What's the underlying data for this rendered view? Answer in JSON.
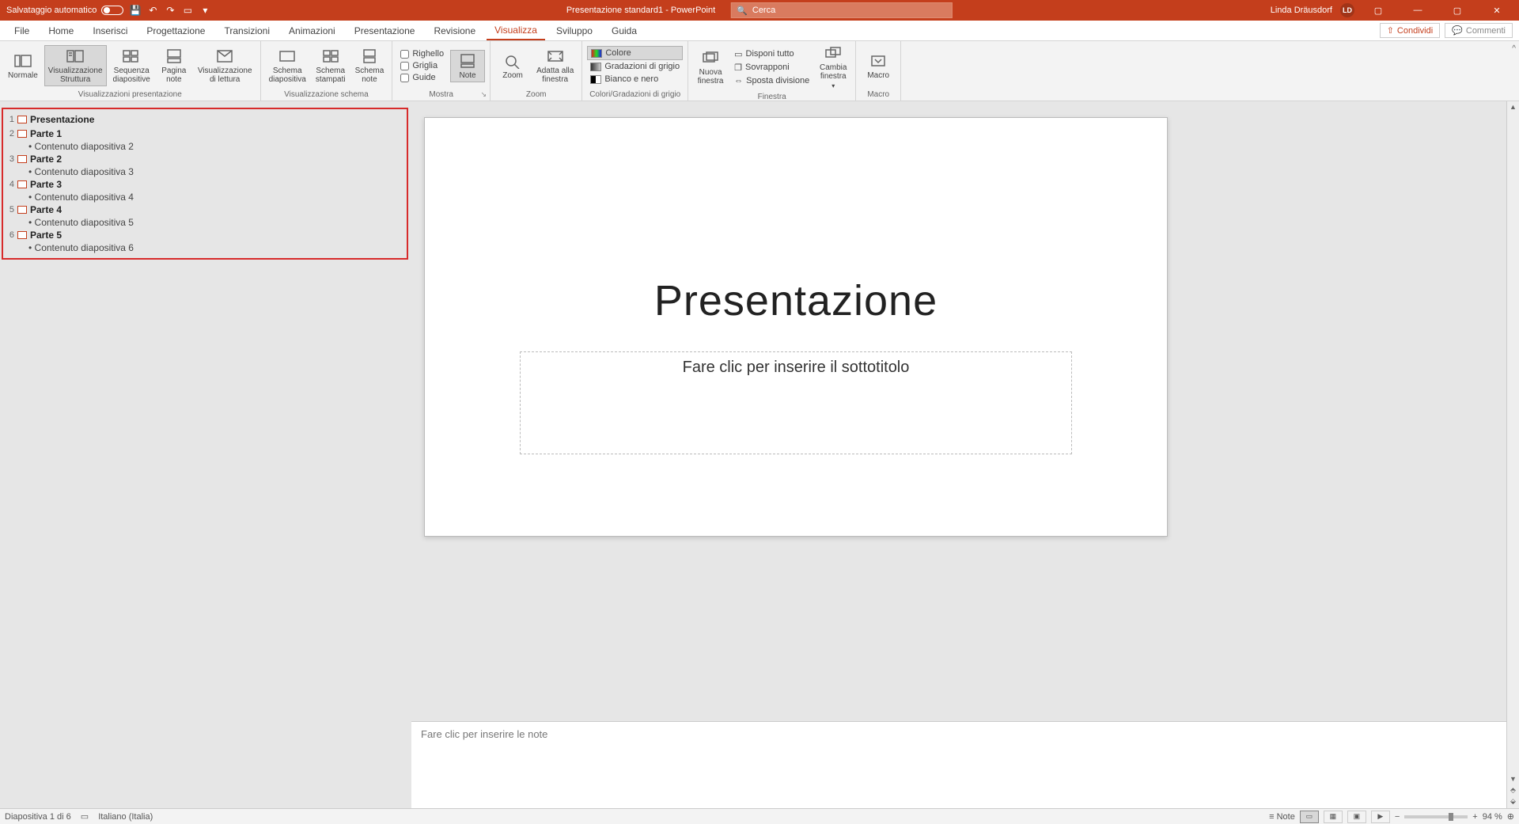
{
  "titlebar": {
    "autosave_label": "Salvataggio automatico",
    "doc_title": "Presentazione standard1 - PowerPoint",
    "search_placeholder": "Cerca",
    "user_name": "Linda Dräusdorf",
    "user_initials": "LD"
  },
  "tabs": {
    "items": [
      "File",
      "Home",
      "Inserisci",
      "Progettazione",
      "Transizioni",
      "Animazioni",
      "Presentazione",
      "Revisione",
      "Visualizza",
      "Sviluppo",
      "Guida"
    ],
    "active": "Visualizza",
    "share": "Condividi",
    "comments": "Commenti"
  },
  "ribbon": {
    "g_presentation_views": {
      "label": "Visualizzazioni presentazione",
      "normal": "Normale",
      "outline": "Visualizzazione\nStruttura",
      "sorter": "Sequenza\ndiapositive",
      "notes_page": "Pagina\nnote",
      "reading": "Visualizzazione\ndi lettura"
    },
    "g_master_views": {
      "label": "Visualizzazione schema",
      "slide_master": "Schema\ndiapositiva",
      "handout_master": "Schema\nstampati",
      "notes_master": "Schema\nnote"
    },
    "g_show": {
      "label": "Mostra",
      "ruler": "Righello",
      "gridlines": "Griglia",
      "guides": "Guide"
    },
    "g_notes": {
      "note": "Note"
    },
    "g_zoom": {
      "label": "Zoom",
      "zoom": "Zoom",
      "fit": "Adatta alla\nfinestra"
    },
    "g_color": {
      "label": "Colori/Gradazioni di grigio",
      "color": "Colore",
      "grayscale": "Gradazioni di grigio",
      "bw": "Bianco e nero"
    },
    "g_window": {
      "label": "Finestra",
      "new_window": "Nuova\nfinestra",
      "arrange_all": "Disponi tutto",
      "cascade": "Sovrapponi",
      "move_split": "Sposta divisione",
      "switch": "Cambia\nfinestra"
    },
    "g_macro": {
      "label": "Macro",
      "macro": "Macro"
    }
  },
  "outline": {
    "items": [
      {
        "num": "1",
        "title": "Presentazione",
        "bullets": []
      },
      {
        "num": "2",
        "title": "Parte 1",
        "bullets": [
          "Contenuto diapositiva 2"
        ]
      },
      {
        "num": "3",
        "title": "Parte 2",
        "bullets": [
          "Contenuto diapositiva 3"
        ]
      },
      {
        "num": "4",
        "title": "Parte 3",
        "bullets": [
          "Contenuto diapositiva 4"
        ]
      },
      {
        "num": "5",
        "title": "Parte 4",
        "bullets": [
          "Contenuto diapositiva 5"
        ]
      },
      {
        "num": "6",
        "title": "Parte 5",
        "bullets": [
          "Contenuto diapositiva 6"
        ]
      }
    ]
  },
  "slide": {
    "title": "Presentazione",
    "subtitle_placeholder": "Fare clic per inserire il sottotitolo"
  },
  "notes": {
    "placeholder": "Fare clic per inserire le note"
  },
  "statusbar": {
    "slide_info": "Diapositiva 1 di 6",
    "language": "Italiano (Italia)",
    "notes_btn": "Note",
    "zoom_pct": "94 %"
  }
}
